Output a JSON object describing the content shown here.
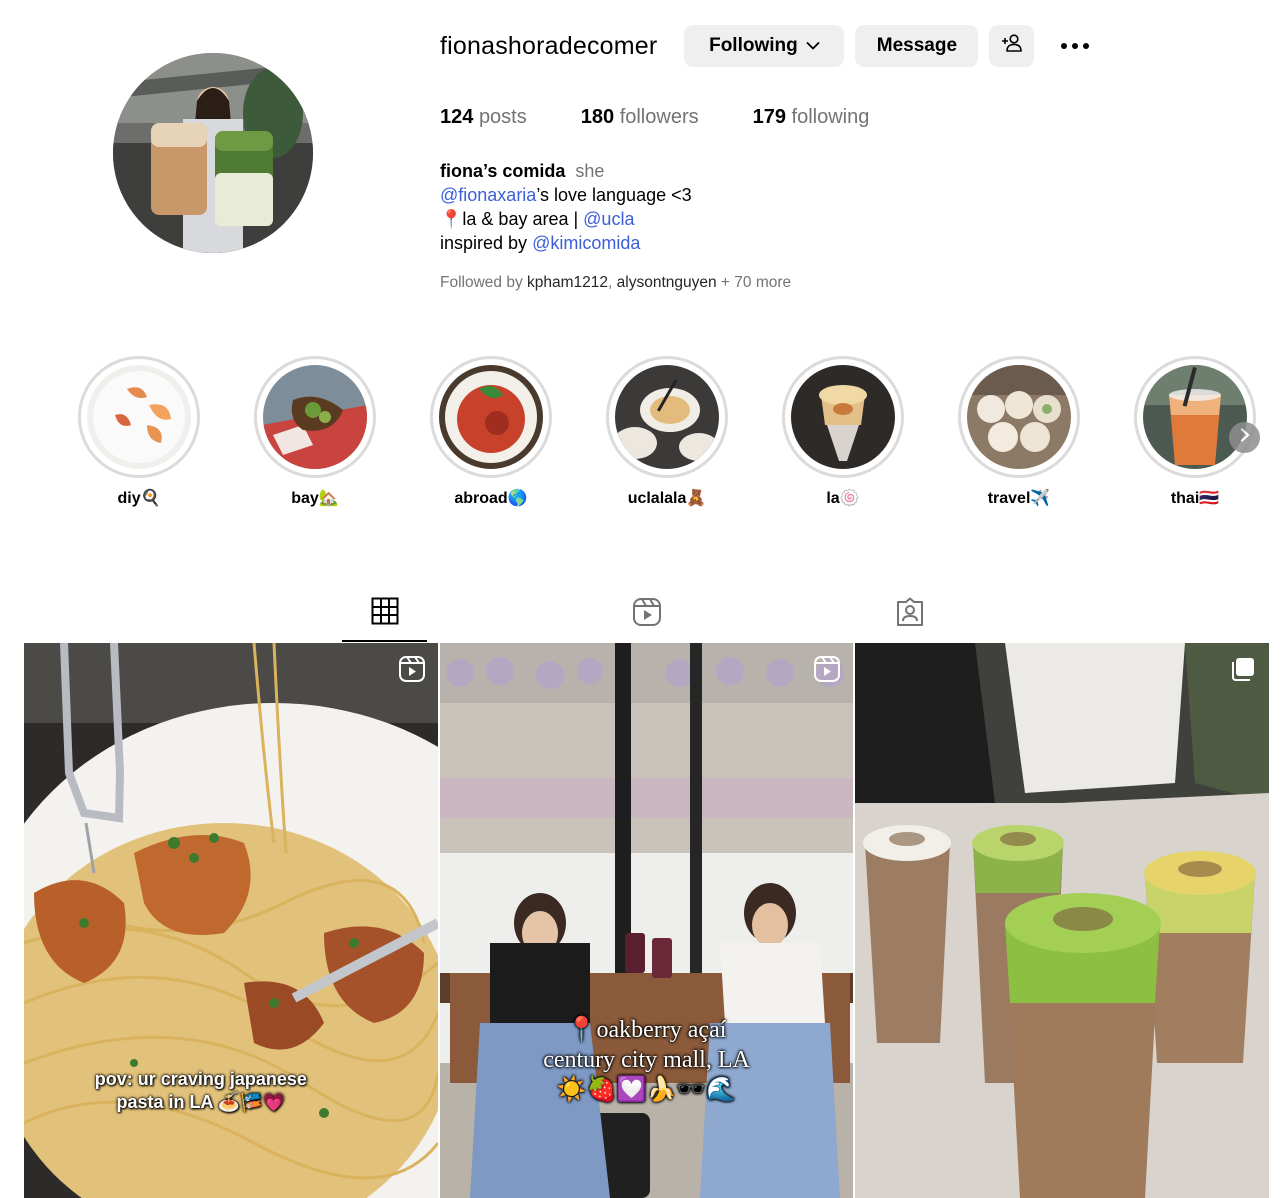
{
  "profile": {
    "username": "fionashoradecomer",
    "following_label": "Following",
    "message_label": "Message",
    "stats": {
      "posts_count": "124",
      "posts_label": "posts",
      "followers_count": "180",
      "followers_label": "followers",
      "following_count": "179",
      "following_label": "following"
    },
    "bio": {
      "name": "fiona’s comida",
      "pronoun": "she",
      "line1_link": "@fionaxaria",
      "line1_rest": "’s love language <3",
      "line2_prefix": "📍la & bay area | ",
      "line2_link": "@ucla",
      "line3_prefix": "inspired by ",
      "line3_link": "@kimicomida"
    },
    "followed_by": {
      "prefix": "Followed by ",
      "user1": "kpham1212",
      "sep": ", ",
      "user2": "alysontnguyen",
      "suffix": " + 70 more"
    }
  },
  "highlights": [
    {
      "label": "diy🍳"
    },
    {
      "label": "bay🏡"
    },
    {
      "label": "abroad🌎"
    },
    {
      "label": "uclalala🧸"
    },
    {
      "label": "la🍥"
    },
    {
      "label": "travel✈️"
    },
    {
      "label": "thai🇹🇭"
    }
  ],
  "tabs": {
    "posts": "grid-icon",
    "reels": "reels-icon",
    "tagged": "tagged-icon"
  },
  "posts": [
    {
      "caption_line1": "pov: ur craving japanese",
      "caption_line2": "pasta in LA 🍝🎏💗",
      "badge": "reel-icon"
    },
    {
      "caption_line1": "📍oakberry açaí",
      "caption_line2": "century city mall, LA",
      "caption_line3": "☀️🍓💟🍌🕶️🌊",
      "badge": "reel-icon"
    },
    {
      "badge": "carousel-icon"
    }
  ]
}
